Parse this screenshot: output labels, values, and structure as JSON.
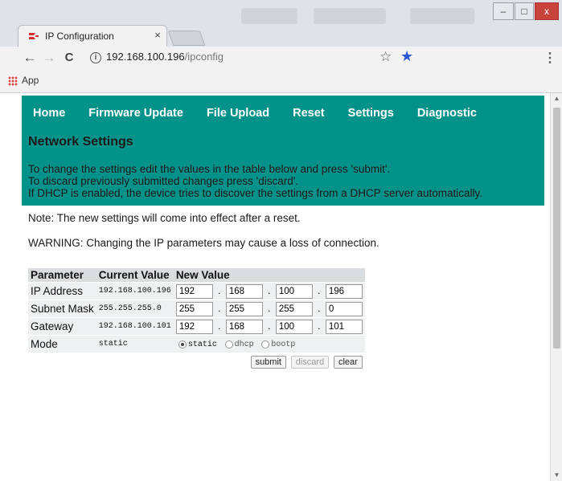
{
  "browser": {
    "tab_title": "IP Configuration",
    "tab_close": "×",
    "url_host": "192.168.100.196",
    "url_path": "/ipconfig",
    "bookmarks": {
      "apps_label": "App"
    },
    "icons": {
      "back": "←",
      "forward": "→",
      "reload": "C",
      "info": "i",
      "star_empty": "☆",
      "star_filled": "★",
      "menu": "⋮",
      "minimize": "–",
      "maximize": "□",
      "close": "x"
    }
  },
  "nav": {
    "items": [
      "Home",
      "Firmware Update",
      "File Upload",
      "Reset",
      "Settings",
      "Diagnostic"
    ]
  },
  "page": {
    "title": "Network Settings",
    "intro_lines": [
      "To change the settings edit the values in the table below and press 'submit'.",
      "To discard previously submitted changes press 'discard'.",
      "If DHCP is enabled, the device tries to discover the settings from a DHCP server automatically."
    ],
    "note": "Note: The new settings will come into effect after a reset.",
    "warning": "WARNING: Changing the IP parameters may cause a loss of connection."
  },
  "table": {
    "headers": [
      "Parameter",
      "Current Value",
      "New Value"
    ],
    "rows": [
      {
        "param": "IP Address",
        "current": "192.168.100.196",
        "octets": [
          "192",
          "168",
          "100",
          "196"
        ]
      },
      {
        "param": "Subnet Mask",
        "current": "255.255.255.0",
        "octets": [
          "255",
          "255",
          "255",
          "0"
        ]
      },
      {
        "param": "Gateway",
        "current": "192.168.100.101",
        "octets": [
          "192",
          "168",
          "100",
          "101"
        ]
      }
    ],
    "octet_separator": ".",
    "mode": {
      "param": "Mode",
      "current": "static",
      "options": [
        "static",
        "dhcp",
        "bootp"
      ],
      "selected": "static"
    },
    "buttons": {
      "submit": "submit",
      "discard": "discard",
      "clear": "clear"
    }
  },
  "colors": {
    "accent": "#03928a",
    "header_cell": "#d9dde0",
    "row_cell": "#eef0f2"
  }
}
